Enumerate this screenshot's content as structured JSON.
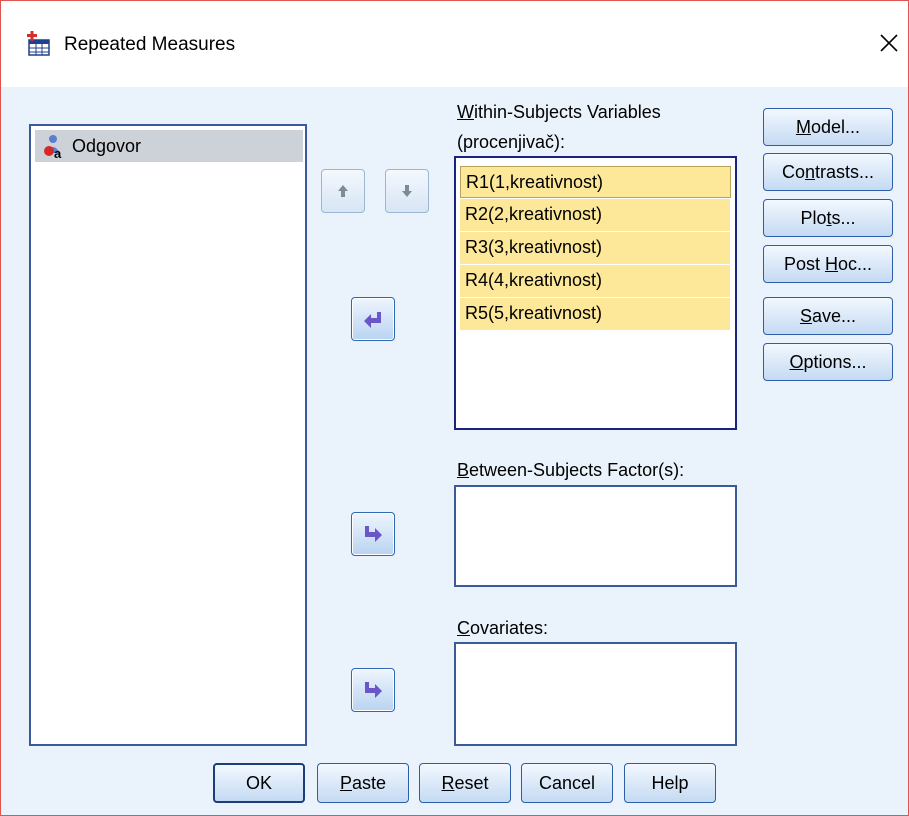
{
  "window": {
    "title": "Repeated Measures"
  },
  "source_list": {
    "items": [
      {
        "label": "Odgovor",
        "icon": "nominal-variable-icon"
      }
    ]
  },
  "within": {
    "label_line1": "Within-Subjects Variables",
    "label_line2": "(procenjivač):",
    "items": [
      "R1(1,kreativnost)",
      "R2(2,kreativnost)",
      "R3(3,kreativnost)",
      "R4(4,kreativnost)",
      "R5(5,kreativnost)"
    ]
  },
  "between": {
    "label": "Between-Subjects Factor(s):"
  },
  "covariates": {
    "label": "Covariates:"
  },
  "side_buttons": {
    "model": "Model...",
    "contrasts": "Contrasts...",
    "plots": "Plots...",
    "posthoc": "Post Hoc...",
    "save": "Save...",
    "options": "Options..."
  },
  "bottom_buttons": {
    "ok": "OK",
    "paste": "Paste",
    "reset": "Reset",
    "cancel": "Cancel",
    "help": "Help"
  },
  "colors": {
    "highlight": "#fde89a",
    "list_border": "#3b5a99",
    "dialog_bg": "#eaf2fb",
    "arrow": "#6a55c9"
  }
}
